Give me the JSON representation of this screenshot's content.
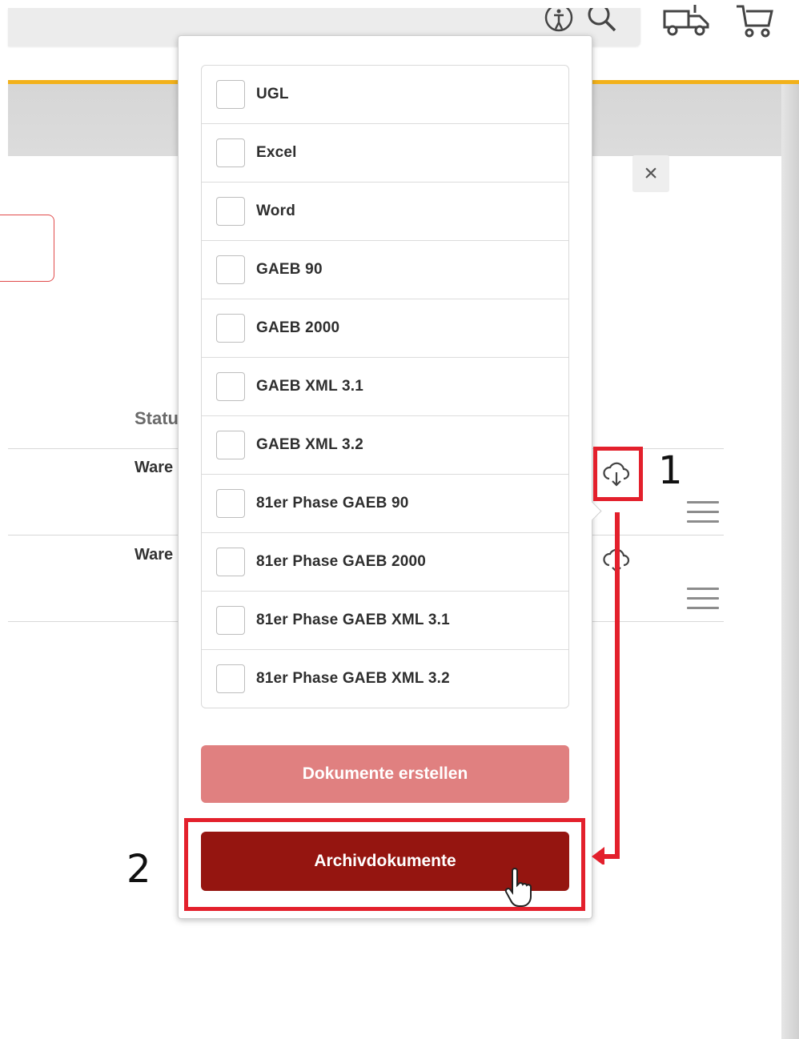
{
  "header": {
    "icons": [
      "accessibility-icon",
      "search-icon",
      "delivery-truck-icon",
      "shopping-cart-icon"
    ]
  },
  "dialog": {
    "close_label": "×"
  },
  "table": {
    "status_header": "Statu",
    "rows": [
      {
        "text": "Ware"
      },
      {
        "text": "Ware"
      }
    ]
  },
  "popover": {
    "options": [
      {
        "label": "UGL",
        "checked": false
      },
      {
        "label": "Excel",
        "checked": false
      },
      {
        "label": "Word",
        "checked": false
      },
      {
        "label": "GAEB 90",
        "checked": false
      },
      {
        "label": "GAEB 2000",
        "checked": false
      },
      {
        "label": "GAEB XML 3.1",
        "checked": false
      },
      {
        "label": "GAEB XML 3.2",
        "checked": false
      },
      {
        "label": "81er Phase GAEB 90",
        "checked": false
      },
      {
        "label": "81er Phase GAEB 2000",
        "checked": false
      },
      {
        "label": "81er Phase GAEB XML 3.1",
        "checked": false
      },
      {
        "label": "81er Phase GAEB XML 3.2",
        "checked": false
      }
    ],
    "create_button": "Dokumente erstellen",
    "archive_button": "Archivdokumente"
  },
  "annotations": {
    "step1": "1",
    "step2": "2",
    "color": "#e3202c"
  },
  "colors": {
    "accent": "#f2b11a",
    "create_button": "#e08080",
    "archive_button": "#951510"
  }
}
